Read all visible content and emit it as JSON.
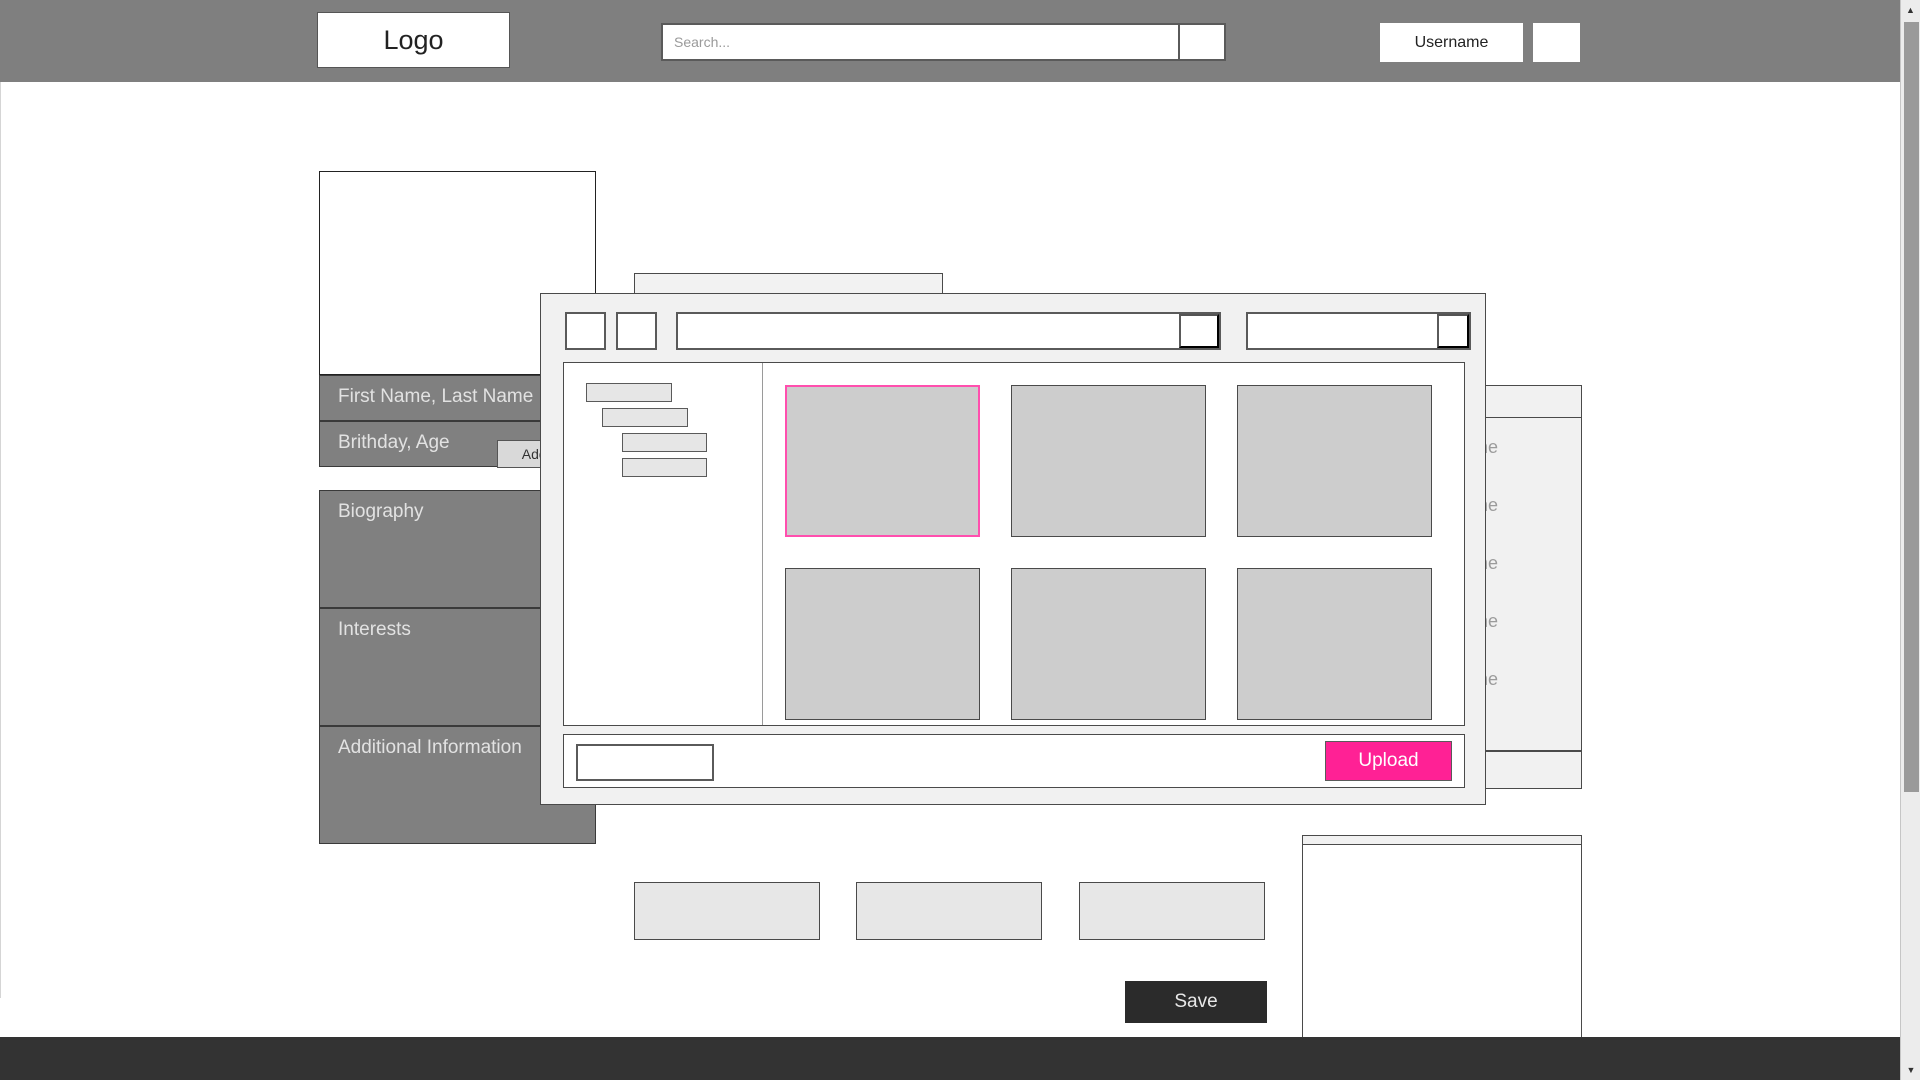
{
  "header": {
    "logo_text": "Logo",
    "search_placeholder": "Search...",
    "search_value": "",
    "search_button_label": "",
    "username_label": "Username",
    "avatar_label": ""
  },
  "profile": {
    "avatar_placeholder": "",
    "add_friend_label": "Add Friend",
    "name_label": "First Name, Last Name",
    "birthday_label": "Brithday, Age",
    "biography_label": "Biography",
    "interests_label": "Interests",
    "additional_label": "Additional Information"
  },
  "center": {
    "field_value": "",
    "upload_button_label": "Upload",
    "mini_field_a": "",
    "mini_field_b": "",
    "mini_field_c": "",
    "save_label": "Save"
  },
  "friends": {
    "header_label": "",
    "rows": [
      {
        "label": "First Name, Last Name"
      },
      {
        "label": "First Name, Last Name"
      },
      {
        "label": "First Name, Last Name"
      },
      {
        "label": "First Name, Last Name"
      },
      {
        "label": "First Name, Last Name"
      }
    ],
    "footer_label": "",
    "stub_label": "",
    "panel_label": ""
  },
  "modal": {
    "back_label": "",
    "forward_label": "",
    "path_value": "",
    "path_placeholder": "",
    "path_go_label": "",
    "search_value": "",
    "search_placeholder": "",
    "search_go_label": "",
    "tree_items": [
      {
        "label": ""
      },
      {
        "label": ""
      },
      {
        "label": ""
      },
      {
        "label": ""
      }
    ],
    "thumbnails": [
      {
        "label": "",
        "selected": true
      },
      {
        "label": "",
        "selected": false
      },
      {
        "label": "",
        "selected": false
      },
      {
        "label": "",
        "selected": false
      },
      {
        "label": "",
        "selected": false
      },
      {
        "label": "",
        "selected": false
      }
    ],
    "filename_value": "",
    "filename_placeholder": "",
    "upload_label": "Upload"
  },
  "scrollbar": {
    "up_arrow": "▲",
    "down_arrow": "▼"
  },
  "colors": {
    "header_bg": "#7f7f7f",
    "footer_bg": "#333333",
    "accent_pink": "#ff2195",
    "selection_pink": "#ff4fae",
    "dark_button": "#2b2b2b",
    "info_block": "#808080"
  }
}
